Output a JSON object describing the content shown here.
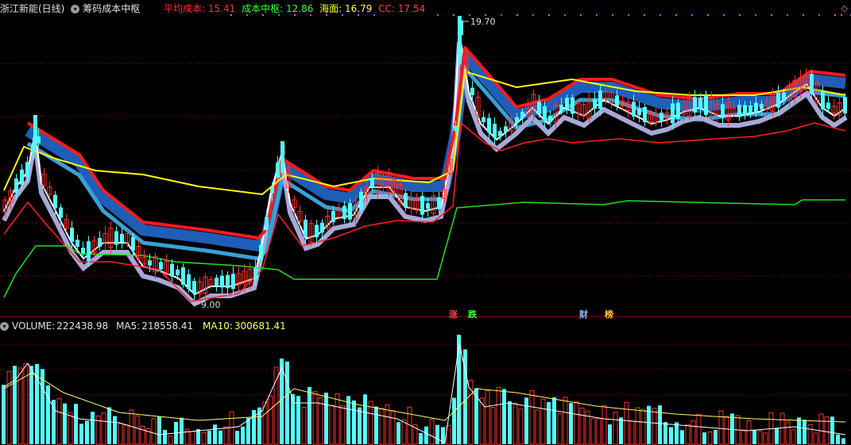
{
  "header": {
    "stock_title": "浙江新能(日线)",
    "indicator_name": "筹码成本中枢",
    "avg_cost_label": "平均成本:",
    "avg_cost_value": "15.41",
    "center_label": "成本中枢:",
    "center_value": "12.86",
    "hai_label": "海面:",
    "hai_value": "16.79",
    "cc_label": "CC:",
    "cc_value": "17.54"
  },
  "colors": {
    "avg_cost": "#ff2020",
    "center": "#20e020",
    "hai": "#ffff00",
    "cc": "#ff4040",
    "up_candle": "#ff3030",
    "down_candle": "#54ffff",
    "ma10_vol": "#ffff66",
    "ma5_vol": "#ffffff"
  },
  "price_labels": {
    "high": "19.70",
    "low": "9.00"
  },
  "events": [
    {
      "label": "涨",
      "color": "#ff4040"
    },
    {
      "label": "跌",
      "color": "#40ff40"
    },
    {
      "label": "财",
      "color": "#80c0ff"
    },
    {
      "label": "榜",
      "color": "#ffcc33"
    }
  ],
  "volume_header": {
    "volume_label": "VOLUME:",
    "volume_value": "222438.98",
    "ma5_label": "MA5:",
    "ma5_value": "218558.41",
    "ma10_label": "MA10:",
    "ma10_value": "300681.41"
  },
  "icons": {
    "settings": "circle-dropdown-icon",
    "corner": "diamond-icon"
  }
}
